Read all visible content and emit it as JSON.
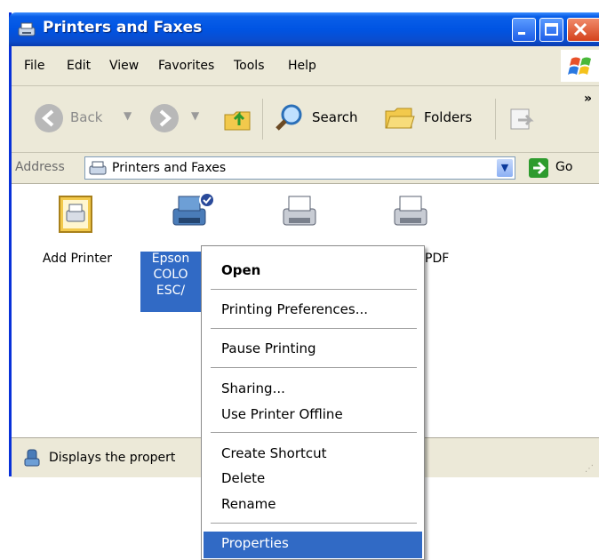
{
  "window": {
    "title": "Printers and Faxes"
  },
  "menu": {
    "items": [
      "File",
      "Edit",
      "View",
      "Favorites",
      "Tools",
      "Help"
    ]
  },
  "toolbar": {
    "back_label": "Back",
    "search_label": "Search",
    "folders_label": "Folders",
    "more_glyph": "»"
  },
  "address": {
    "label": "Address",
    "value": "Printers and Faxes",
    "go_label": "Go"
  },
  "printers": [
    {
      "label": "Add Printer"
    },
    {
      "label_lines": [
        "Epson ",
        "COLO",
        "ESC/"
      ]
    },
    {
      "label": ""
    },
    {
      "label": "PDF"
    }
  ],
  "status": {
    "text": "Displays the propert"
  },
  "context_menu": {
    "items": [
      {
        "label": "Open"
      },
      {
        "label": "Printing Preferences..."
      },
      {
        "label": "Pause Printing"
      },
      {
        "label": "Sharing..."
      },
      {
        "label": "Use Printer Offline"
      },
      {
        "label": "Create Shortcut"
      },
      {
        "label": "Delete"
      },
      {
        "label": "Rename"
      },
      {
        "label": "Properties"
      }
    ]
  },
  "colors": {
    "titlebar_blue": "#0054e3",
    "selection_blue": "#316ac5",
    "chrome_beige": "#ece9d8"
  }
}
